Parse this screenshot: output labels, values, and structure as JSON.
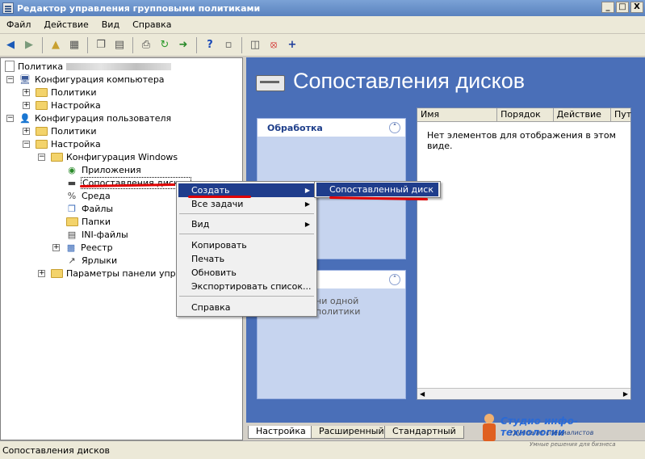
{
  "window": {
    "title": "Редактор управления групповыми политиками",
    "minimize": "_",
    "maximize": "□",
    "close": "X"
  },
  "menu": [
    "Файл",
    "Действие",
    "Вид",
    "Справка"
  ],
  "tree": {
    "root": "Политика",
    "computer_config": "Конфигурация компьютера",
    "cc_policies": "Политики",
    "cc_settings": "Настройка",
    "user_config": "Конфигурация пользователя",
    "uc_policies": "Политики",
    "uc_settings": "Настройка",
    "windows_config": "Конфигурация Windows",
    "applications": "Приложения",
    "drive_maps": "Сопоставления дисков",
    "environment": "Среда",
    "files": "Файлы",
    "folders": "Папки",
    "ini_files": "INI-файлы",
    "registry": "Реестр",
    "shortcuts": "Ярлыки",
    "control_panel": "Параметры панели управл"
  },
  "main": {
    "title": "Сопоставления дисков",
    "tasks_header": "Обработка",
    "tasks2_text": "ни одной политики",
    "columns": [
      "Имя",
      "Порядок",
      "Действие",
      "Пут"
    ],
    "empty_text": "Нет элементов для отображения в этом виде."
  },
  "tabs": [
    "Настройка",
    "Расширенный",
    "Стандартный"
  ],
  "context_menu": {
    "create": "Создать",
    "all_tasks": "Все задачи",
    "view": "Вид",
    "copy": "Копировать",
    "print": "Печать",
    "refresh": "Обновить",
    "export": "Экспортировать список...",
    "help": "Справка"
  },
  "submenu": {
    "mapped_drive": "Сопоставленный диск"
  },
  "status": "Сопоставления дисков",
  "watermark": {
    "title": "Студио инфо-технологии",
    "subtitle": "группа ит специалистов",
    "tagline": "Умные решения для бизнеса"
  }
}
